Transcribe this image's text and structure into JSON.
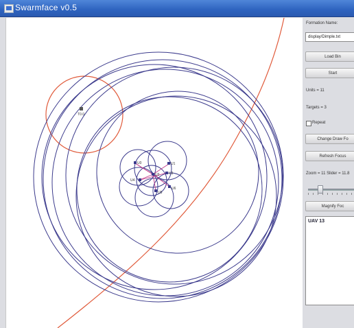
{
  "window": {
    "title": "Swarmface v0.5"
  },
  "panel": {
    "formation_label": "Formation Name:",
    "formation_value": "display/Dimple.txt",
    "load_button": "Load Bin",
    "start_button": "Start",
    "units_label": "Units = 11",
    "targets_label": "Targets = 3",
    "repeat_label": "Repeat",
    "repeat_checked": false,
    "change_button": "Change Draw Fo",
    "refresh_button": "Refresh Focus",
    "zoom_label": "Zoom = 11 Slider = 11.8",
    "zoom_slider_fraction": 0.2,
    "magnify_button": "Magnify Foc",
    "info_text": "UAV 13"
  },
  "canvas": {
    "colors": {
      "circle": "#3b3a8c",
      "curve": "#e05a3a",
      "link": "#c03a8a"
    },
    "target_label": "T0.0",
    "nodes": [
      {
        "label": "U0"
      },
      {
        "label": "U1"
      },
      {
        "label": "U2"
      },
      {
        "label": "U3"
      },
      {
        "label": "U4"
      },
      {
        "label": "U5"
      },
      {
        "label": "U6"
      }
    ]
  }
}
